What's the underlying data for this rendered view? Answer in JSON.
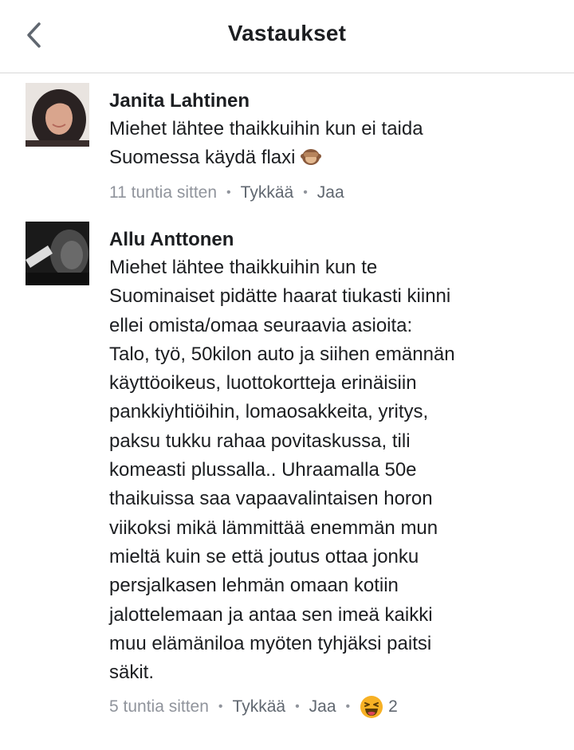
{
  "header": {
    "title": "Vastaukset",
    "back_icon": "chevron-left-icon"
  },
  "comments": [
    {
      "author": "Janita Lahtinen",
      "lines": [
        "Miehet lähtee thaikkuihin kun ei taida",
        "Suomessa käydä flaxi"
      ],
      "inline_emoji": "see-no-evil-monkey-icon",
      "time": "11 tuntia sitten",
      "like_label": "Tykkää",
      "share_label": "Jaa",
      "separator": "•"
    },
    {
      "author": "Allu Anttonen",
      "lines": [
        "Miehet lähtee thaikkuihin kun te",
        "Suominaiset pidätte haarat tiukasti kiinni",
        "ellei omista/omaa seuraavia asioita:",
        "Talo, työ, 50kilon auto ja siihen emännän",
        "käyttöoikeus, luottokortteja erinäisiin",
        "pankkiyhtiöihin, lomaosakkeita, yritys,",
        "paksu tukku rahaa povitaskussa, tili",
        "komeasti plussalla.. Uhraamalla 50e",
        "thaikuissa saa vapaavalintaisen horon",
        "viikoksi mikä lämmittää enemmän mun",
        "mieltä kuin se että joutus ottaa jonku",
        "persjalkasen lehmän omaan kotiin",
        "jalottelemaan ja antaa sen imeä kaikki",
        "muu elämäniloa myöten tyhjäksi paitsi",
        "säkit."
      ],
      "time": "5 tuntia sitten",
      "like_label": "Tykkää",
      "share_label": "Jaa",
      "separator": "•",
      "reaction": {
        "icon": "haha-reaction-icon",
        "count": "2",
        "color": "#f7b125"
      }
    }
  ]
}
